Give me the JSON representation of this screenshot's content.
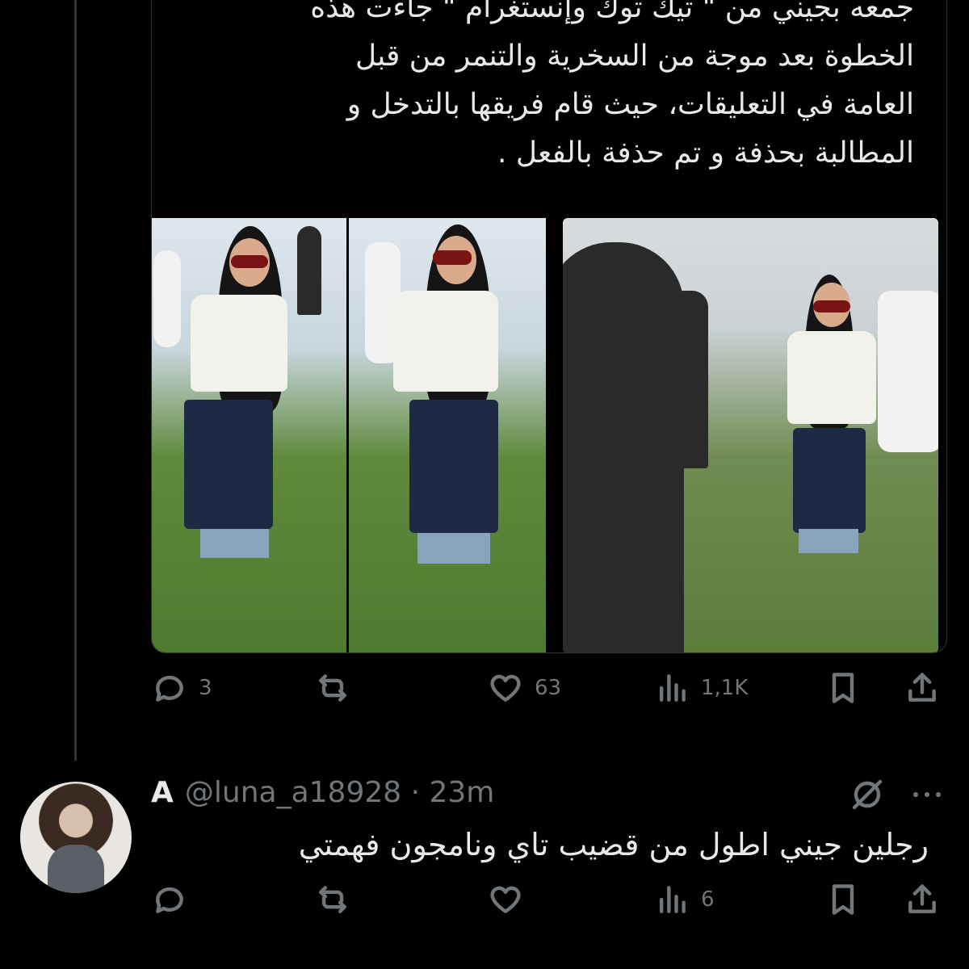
{
  "quote": {
    "lines": [
      "جمعه بجيني من \" تيك توك وإنستغرام \" جاءت هذه",
      "الخطوة بعد موجة من السخرية والتنمر من قبل",
      "العامة في التعليقات، حيث قام فريقها بالتدخل و",
      "المطالبة بحذفة و تم حذفة بالفعل ."
    ],
    "media": [
      {
        "name": "photo-woman-denim-skirt-1"
      },
      {
        "name": "photo-woman-denim-skirt-2"
      },
      {
        "name": "photo-woman-denim-skirt-3"
      }
    ]
  },
  "post_actions": {
    "reply_count": "3",
    "repost_count": "",
    "like_count": "63",
    "views_count": "1,1K",
    "icons": [
      "reply-icon",
      "repost-icon",
      "like-icon",
      "views-icon",
      "bookmark-icon",
      "share-icon"
    ]
  },
  "reply": {
    "name": "A",
    "handle_time": "@luna_a18928 · 23m",
    "text": "رجلين جيني اطول من قضيب تاي ونامجون فهمتي",
    "actions": {
      "reply_count": "",
      "repost_count": "",
      "like_count": "",
      "views_count": "6"
    }
  },
  "colors": {
    "background": "#000000",
    "text": "#e7e9ea",
    "muted": "#71767b",
    "border": "#2f3336"
  }
}
